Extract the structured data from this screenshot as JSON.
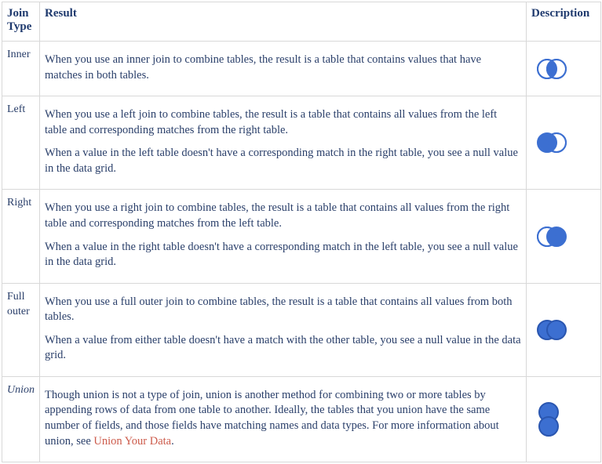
{
  "headers": {
    "join_type": "Join Type",
    "result": "Result",
    "description": "Description"
  },
  "rows": {
    "inner": {
      "label": "Inner",
      "p1": "When you use an inner join to combine tables, the result is a table that contains values that have matches in both tables."
    },
    "left": {
      "label": "Left",
      "p1": "When you use a left join to combine tables, the result is a table that contains all values from the left table and corresponding matches from the right table.",
      "p2": "When a value in the left table doesn't have a corresponding match in the right table, you see a null value in the data grid."
    },
    "right": {
      "label": "Right",
      "p1": "When you use a right join to combine tables, the result is a table that contains all values from the right table and corresponding matches from the left table.",
      "p2": "When a value in the right table doesn't have a corresponding match in the left table, you see a null value in the data grid."
    },
    "fullouter": {
      "label": "Full outer",
      "p1": "When you use a full outer join to combine tables, the result is a table that contains all values from both tables.",
      "p2": "When a value from either table doesn't have a match with the other table, you see a null value in the data grid."
    },
    "union": {
      "label": "Union",
      "p1_a": "Though union is not a type of join, union is another method for combining two or more tables by appending rows of data from one table to another. Ideally, the tables that you union have the same number of fields, and those fields have matching names and data types. For more information about union, see ",
      "link": "Union Your Data",
      "p1_b": "."
    }
  }
}
